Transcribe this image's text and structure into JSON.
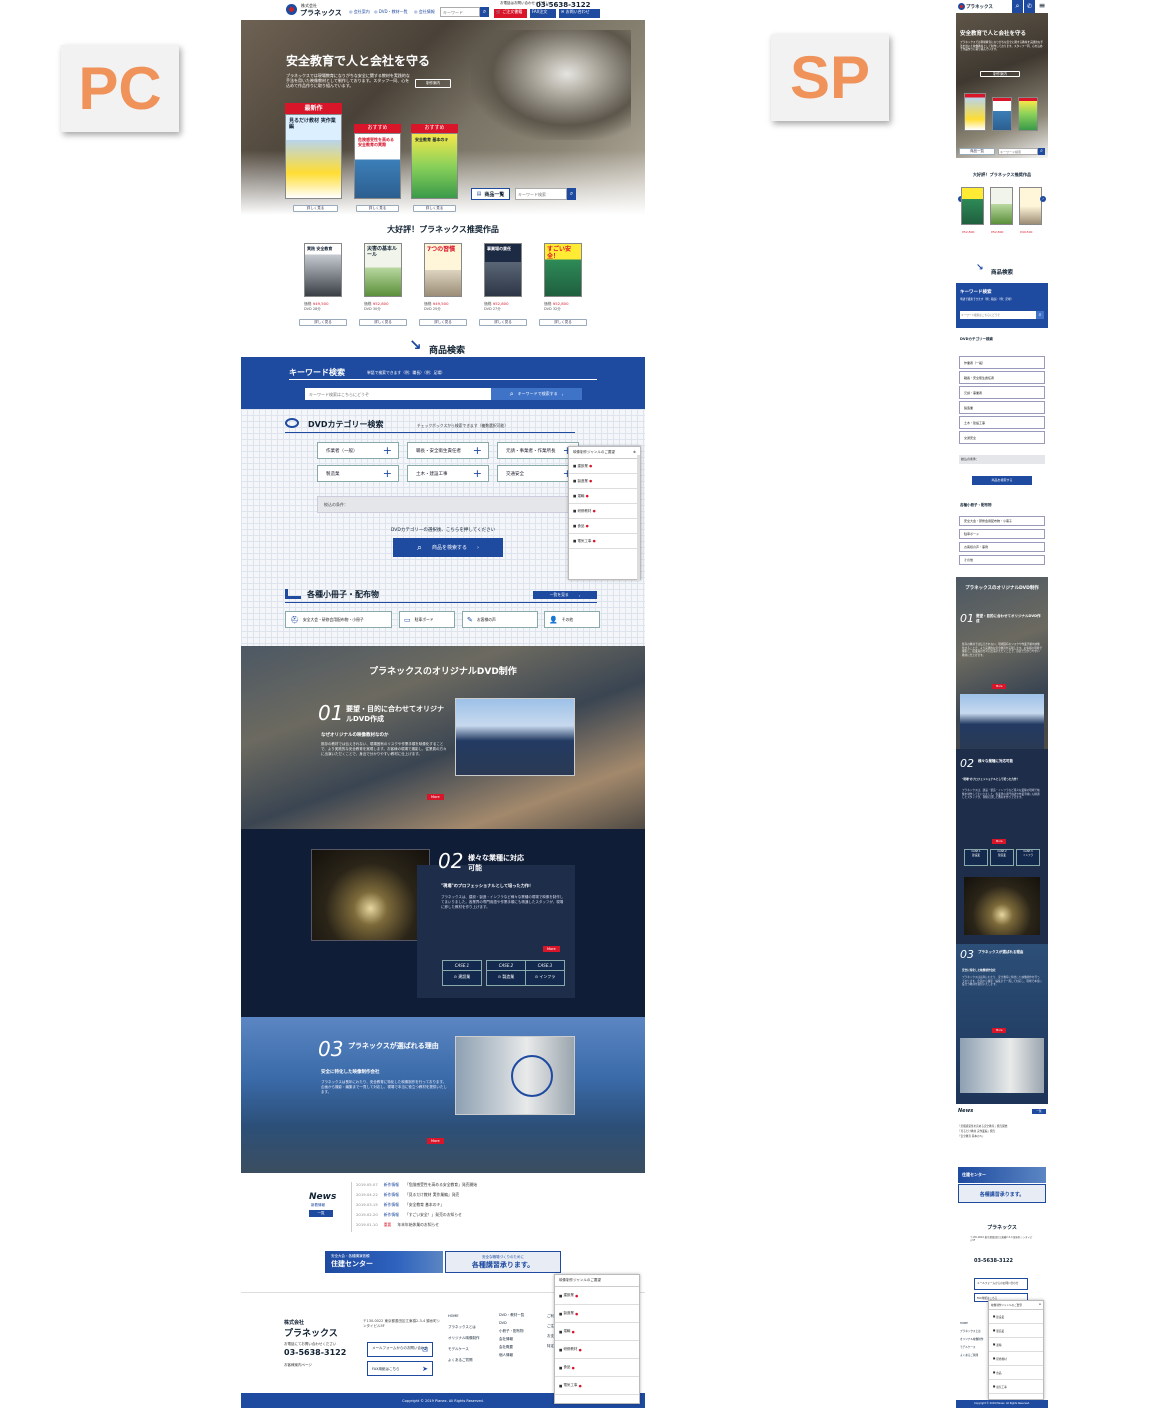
{
  "labels": {
    "pc": "PC",
    "sp": "SP"
  },
  "header": {
    "company_small": "株式会社",
    "company": "プラネックス",
    "nav": [
      "◎ 会社案内",
      "◎ DVD・教材一覧",
      "◎ 会社情報"
    ],
    "search_placeholder": "キーワード",
    "tel_note": "お電話はお問い合わせください",
    "tel": "03-5638-3122",
    "cart": "ご注文書籍",
    "fax": "FAX注文",
    "contact": "お問い合わせ"
  },
  "hero": {
    "title": "安全教育で人と会社を守る",
    "text": "プラネックスでは現場教育になりがちな安全に関する教材を実践的な手法を用いた映像教材として制作しております。スタッフ一同、心を込めて作品作りに取り組んでいます。",
    "company_btn": "制作案内",
    "badges": [
      "最新作",
      "おすすめ",
      "おすすめ"
    ],
    "cover_titles": [
      "見るだけ教材 実作業編",
      "危険感受性を高める 安全教育の実際",
      "安全教育 基本のキ"
    ],
    "detail": "詳しく見る",
    "products_btn": "商品一覧",
    "keyword_placeholder": "キーワード検索"
  },
  "recommend": {
    "title": "大好評！プラネックス推奨作品",
    "items": [
      {
        "cover": "実践 安全教育",
        "price": "¥49,500",
        "info": "DVD 28分"
      },
      {
        "cover": "災害の基本ルール",
        "price": "¥52,800",
        "info": "DVD 30分"
      },
      {
        "cover": "7つの習慣",
        "price": "¥49,500",
        "info": "DVD 25分"
      },
      {
        "cover": "事業場の責任",
        "price": "¥52,800",
        "info": "DVD 27分"
      },
      {
        "cover": "すごい安全！",
        "price": "¥52,800",
        "info": "DVD 32分"
      }
    ],
    "price_label": "価格",
    "detail": "詳しく見る"
  },
  "search": {
    "heading": "商品検索",
    "keyword_title": "キーワード検索",
    "keyword_note": "単語で検索できます（例：職長）（例：足場）",
    "keyword_placeholder": "キーワード検索はこちらにどうぞ",
    "keyword_button": "キーワードで検索する"
  },
  "dvd": {
    "title": "DVDカテゴリー検索",
    "note": "チェックボックスから検索できます（複数選択可能）",
    "cats": [
      "作業者（一般）",
      "職長・安全衛生責任者",
      "元請・事業者・作業所長",
      "製造業",
      "土木・建設工事",
      "交通安全"
    ],
    "filter_label": "絞込の条件：",
    "hint": "DVDカテゴリーの選択後、こちらを押してください",
    "button": "商品を検索する"
  },
  "popup": {
    "title": "映像制作ジャンルのご要望",
    "items": [
      "建設業",
      "製造業",
      "運輸",
      "研修教材",
      "食品",
      "電気工事"
    ]
  },
  "booklet": {
    "title": "各種小冊子・配布物",
    "more": "一覧を見る",
    "items": [
      "安全大会・研修会用配布物・小冊子",
      "駐車ボード",
      "お客様の声",
      "その他"
    ]
  },
  "original": {
    "title": "プラネックスのオリジナルDVD制作",
    "s1_num": "01",
    "s1_title": "要望・目的に合わせてオリジナルDVD作成",
    "s1_sub": "なぜオリジナルの映像教材なのか",
    "s1_text": "既存の教材では伝えきれない、現場固有のリスクや作業手順を映像化することで、より実践的な安全教育を実現します。お客様の現場で撮影し、従業員の方々に出演いただくことで、身近で分かりやすい教材に仕上げます。",
    "s2_num": "02",
    "s2_title": "様々な業種に対応可能",
    "s2_sub": "\"現場\"のプロフェッショナルとして培った力作！",
    "s2_text": "プラネックスは、建設・製造・インフラなど様々な業種の現場で映像を制作してまいりました。各業界の専門用語や作業手順にも精通したスタッフが、現場に即した教材を作り上げます。",
    "cases": [
      {
        "label": "CASE.1",
        "name": "建設業"
      },
      {
        "label": "CASE.2",
        "name": "製造業"
      },
      {
        "label": "CASE.3",
        "name": "インフラ"
      }
    ],
    "s3_num": "03",
    "s3_title": "プラネックスが選ばれる理由",
    "s3_sub": "安全に特化した映像制作会社",
    "s3_text": "プラネックスは長年にわたり、安全教育に特化した映像制作を行っております。企画から撮影・編集まで一貫して対応し、現場で本当に役立つ教材を提供いたします。",
    "more": "More"
  },
  "news": {
    "title": "News",
    "sub": "新着情報",
    "more": "一覧",
    "items": [
      {
        "date": "2019.05.07",
        "cat": "新作情報",
        "text": "「危険感受性を高める安全教育」発売開始"
      },
      {
        "date": "2019.04.22",
        "cat": "新作情報",
        "text": "「見るだけ教材 実作業編」発売"
      },
      {
        "date": "2019.03.15",
        "cat": "新作情報",
        "text": "「安全教育 基本のキ」"
      },
      {
        "date": "2019.02.20",
        "cat": "新作情報",
        "text": "「すごい安全！」発売のお知らせ"
      },
      {
        "date": "2019.01.10",
        "cat": "重要",
        "text": "年末年始休業のお知らせ"
      }
    ]
  },
  "banners": {
    "left_small": "安全大会・各種講演依頼",
    "left_big": "住建センター",
    "right_small": "安全な職場づくりのために",
    "right_big": "各種講習承ります。"
  },
  "footer": {
    "company_small": "株式会社",
    "company": "プラネックス",
    "address": "〒130-0022 東京都墨田区江東橋2-3-4 錦糸町シンタイビル5F",
    "tel_note": "お電話にてお問い合わせください",
    "tel": "03-5638-3122",
    "map": "お客様案内ページ",
    "mail_btn": "メールフォームからのお問い合わせ",
    "fax_btn": "FAX用紙はこちら",
    "links": [
      "HOME",
      "プラネックスとは",
      "オリジナル映像制作",
      "モデルケース",
      "よくあるご質問"
    ],
    "links2": [
      "DVD・教材一覧",
      "DVD",
      "小冊子・配布物",
      "会社情報",
      "会社概要",
      "個人情報"
    ],
    "links3": [
      "ご利用案内",
      "ご注文方法",
      "お支払い",
      "特定商取引"
    ],
    "copyright": "Copyright © 2019 Planex. All Rights Reserved."
  },
  "sp": {
    "menu": "MENU",
    "dvd_title": "DVDカテゴリー検索",
    "cats": [
      "作業者（一般）",
      "職長・安全衛生責任者",
      "元請・事業者",
      "製造業",
      "土木・建設工事",
      "交通安全"
    ],
    "booklets": [
      "安全大会・研修会用配布物・小冊子",
      "駐車ボード",
      "お客様の声・事例",
      "その他"
    ]
  }
}
